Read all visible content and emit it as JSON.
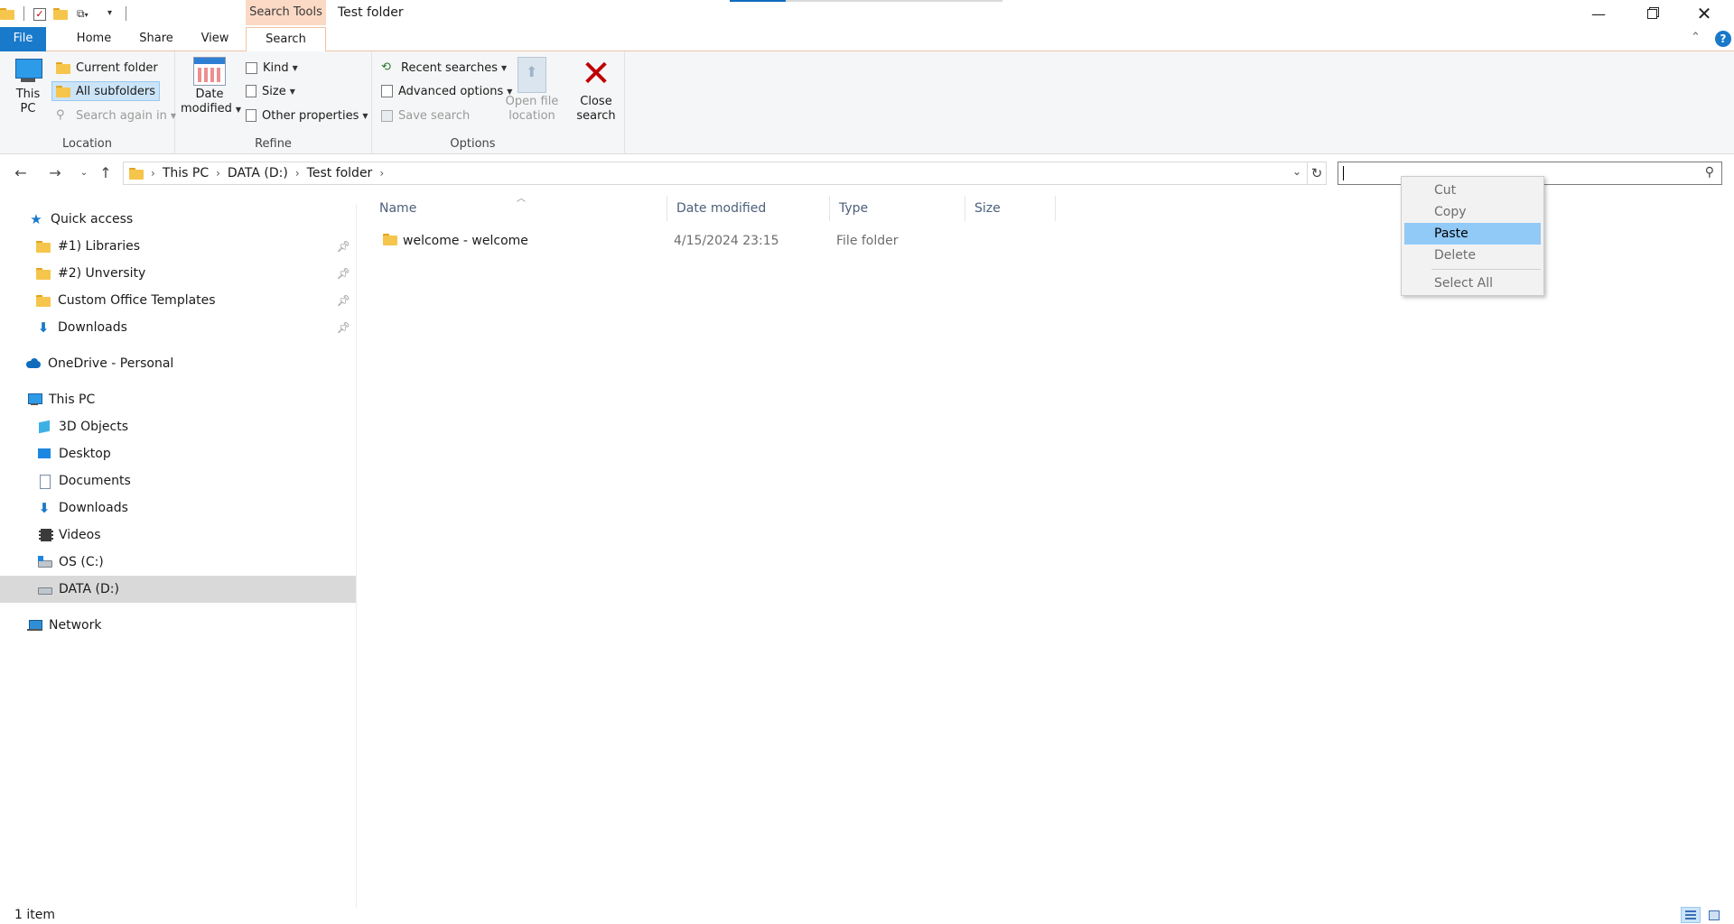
{
  "window": {
    "title": "Test folder",
    "context_tab_group": "Search Tools"
  },
  "tabs": [
    {
      "label": "File"
    },
    {
      "label": "Home"
    },
    {
      "label": "Share"
    },
    {
      "label": "View"
    },
    {
      "label": "Search"
    }
  ],
  "ribbon": {
    "location": {
      "group_label": "Location",
      "this_pc_line1": "This",
      "this_pc_line2": "PC",
      "current_folder": "Current folder",
      "all_subfolders": "All subfolders",
      "search_again_in": "Search again in"
    },
    "refine": {
      "group_label": "Refine",
      "date_modified_line1": "Date",
      "date_modified_line2": "modified",
      "kind": "Kind",
      "size": "Size",
      "other_properties": "Other properties"
    },
    "options": {
      "group_label": "Options",
      "recent_searches": "Recent searches",
      "advanced_options": "Advanced options",
      "save_search": "Save search",
      "open_file_location_line1": "Open file",
      "open_file_location_line2": "location",
      "close_search_line1": "Close",
      "close_search_line2": "search"
    }
  },
  "address": {
    "breadcrumbs": [
      "This PC",
      "DATA (D:)",
      "Test folder"
    ]
  },
  "search": {
    "value": ""
  },
  "nav_pane": {
    "quick_access": "Quick access",
    "pinned": [
      {
        "label": "#1) Libraries"
      },
      {
        "label": "#2) Unversity"
      },
      {
        "label": "Custom Office Templates"
      },
      {
        "label": "Downloads"
      }
    ],
    "onedrive": "OneDrive - Personal",
    "this_pc": "This PC",
    "this_pc_items": [
      {
        "label": "3D Objects"
      },
      {
        "label": "Desktop"
      },
      {
        "label": "Documents"
      },
      {
        "label": "Downloads"
      },
      {
        "label": "Videos"
      },
      {
        "label": "OS (C:)"
      },
      {
        "label": "DATA (D:)"
      }
    ],
    "network": "Network",
    "selected": "DATA (D:)"
  },
  "file_list": {
    "columns": [
      "Name",
      "Date modified",
      "Type",
      "Size"
    ],
    "rows": [
      {
        "name": "welcome - welcome",
        "date_modified": "4/15/2024 23:15",
        "type": "File folder",
        "size": ""
      }
    ]
  },
  "context_menu": {
    "items": [
      {
        "label": "Cut",
        "enabled": false
      },
      {
        "label": "Copy",
        "enabled": false
      },
      {
        "label": "Paste",
        "enabled": true,
        "highlighted": true
      },
      {
        "label": "Delete",
        "enabled": false
      },
      {
        "label": "Select All",
        "enabled": false
      }
    ]
  },
  "status": {
    "item_count": "1 item"
  },
  "colors": {
    "accent": "#1979ca",
    "context_tab": "#fbd9c4",
    "menu_highlight": "#91c9f7",
    "selection": "#d9d9d9"
  }
}
